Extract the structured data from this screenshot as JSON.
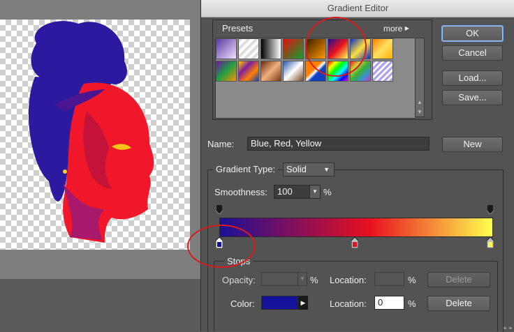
{
  "dialog": {
    "title": "Gradient Editor",
    "presets_label": "Presets",
    "more_label": "more",
    "presets": [
      [
        "violet-orange",
        "transparent-stripes",
        "black-white",
        "red-green",
        "black-orange",
        "blue-red-yellow",
        "blue-yellow-blue",
        "orange-yellow"
      ],
      [
        "violet-green-orange",
        "yellow-violet-orange-blue",
        "copper",
        "chrome",
        "steel-bar",
        "spectrum",
        "transparent-rainbow",
        "transparent-stripes-2"
      ]
    ],
    "buttons": {
      "ok": "OK",
      "cancel": "Cancel",
      "load": "Load...",
      "save": "Save...",
      "new": "New"
    },
    "name_label": "Name:",
    "name_value": "Blue, Red, Yellow",
    "gradient_type_label": "Gradient Type:",
    "gradient_type_value": "Solid",
    "smoothness_label": "Smoothness:",
    "smoothness_value": "100",
    "percent": "%",
    "gradient": {
      "colors": [
        "#1c1096",
        "#e8101e",
        "#ffff50"
      ],
      "color_stops": [
        0,
        55,
        100
      ],
      "opacity_stops": [
        0,
        100
      ]
    },
    "stops": {
      "title": "Stops",
      "opacity_label": "Opacity:",
      "opacity_value": "",
      "location_label": "Location:",
      "opacity_location_value": "",
      "delete_label": "Delete",
      "color_label": "Color:",
      "color_value": "#14129a",
      "color_location_value": "0"
    }
  }
}
